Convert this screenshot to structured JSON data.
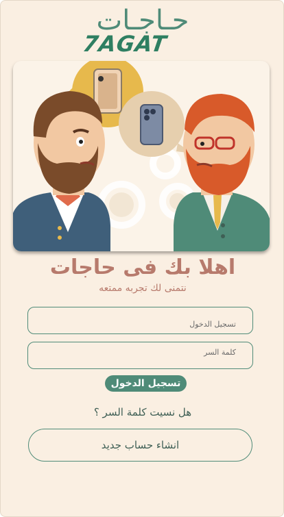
{
  "brand": {
    "logo_arabic": "حـاجـات",
    "logo_latin": "7AGAT",
    "primary_color": "#4f8b78",
    "accent_color": "#b77a6c",
    "background_color": "#faefe2"
  },
  "hero": {
    "illustration": "two-bearded-men-exchanging-smartphones"
  },
  "welcome": {
    "title": "اهلا بك فى حاجات",
    "subtitle": "نتمنى لك تجربه ممتعه"
  },
  "form": {
    "username_placeholder": "تسجيل الدخول",
    "password_placeholder": "كلمة السر",
    "login_label": "تسجيل الدخول",
    "forgot_label": "هل نسيت كلمة السر ؟",
    "signup_label": "انشاء حساب جديد"
  }
}
